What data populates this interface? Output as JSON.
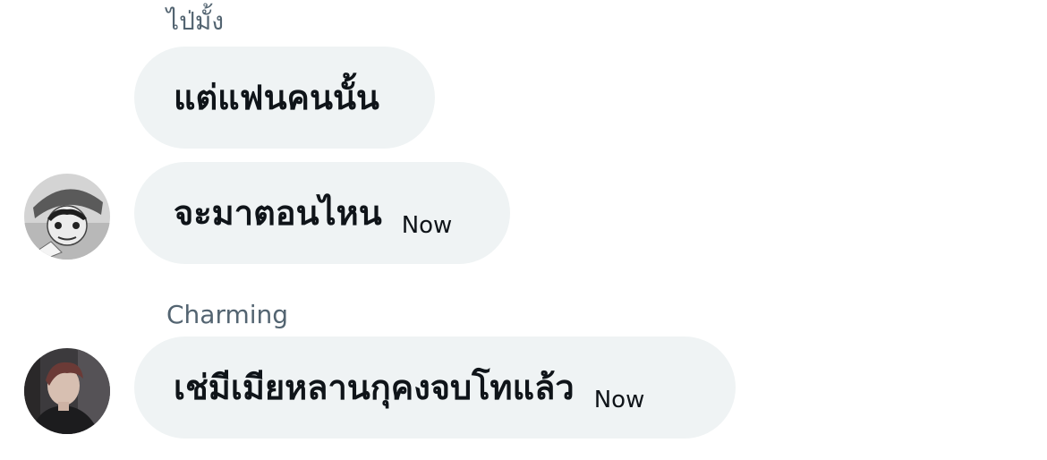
{
  "messages": [
    {
      "sender_name": "ไป่มั้ง",
      "text": "แต่แฟนคนนั้น",
      "timestamp": ""
    },
    {
      "sender_name": "",
      "text": "จะมาตอนไหน",
      "timestamp": "Now",
      "avatar": "anime-character-avatar"
    },
    {
      "sender_name": "Charming",
      "text": "เช่มีเมียหลานกุคงจบโทแล้ว",
      "timestamp": "Now",
      "avatar": "person-photo-avatar"
    }
  ],
  "colors": {
    "bubble_bg": "#eff3f4",
    "text_primary": "#0f1419",
    "text_secondary": "#536471"
  }
}
